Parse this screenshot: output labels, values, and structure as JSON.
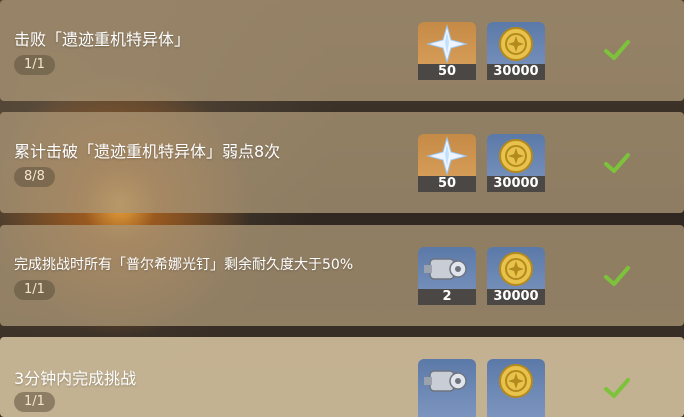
{
  "tasks": [
    {
      "title": "击败「遗迹重机特异体」",
      "progress": "1/1",
      "rewards": [
        {
          "icon": "primogem-icon",
          "count": "50"
        },
        {
          "icon": "mora-coin-icon",
          "count": "30000"
        }
      ],
      "completed": true
    },
    {
      "title": "累计击破「遗迹重机特异体」弱点8次",
      "progress": "8/8",
      "rewards": [
        {
          "icon": "primogem-icon",
          "count": "50"
        },
        {
          "icon": "mora-coin-icon",
          "count": "30000"
        }
      ],
      "completed": true
    },
    {
      "title": "完成挑战时所有「普尔希娜光钉」剩余耐久度大于50%",
      "progress": "1/1",
      "rewards": [
        {
          "icon": "hero-wit-icon",
          "count": "2"
        },
        {
          "icon": "mora-coin-icon",
          "count": "30000"
        }
      ],
      "completed": true
    },
    {
      "title": "3分钟内完成挑战",
      "progress": "1/1",
      "rewards": [
        {
          "icon": "hero-wit-icon",
          "count": ""
        },
        {
          "icon": "mora-coin-icon",
          "count": ""
        }
      ],
      "completed": true
    }
  ],
  "colors": {
    "check": "#7cc23a",
    "panel": "#aa9676",
    "panel_active": "#d6c4a0",
    "count_bar": "#4a4744"
  }
}
